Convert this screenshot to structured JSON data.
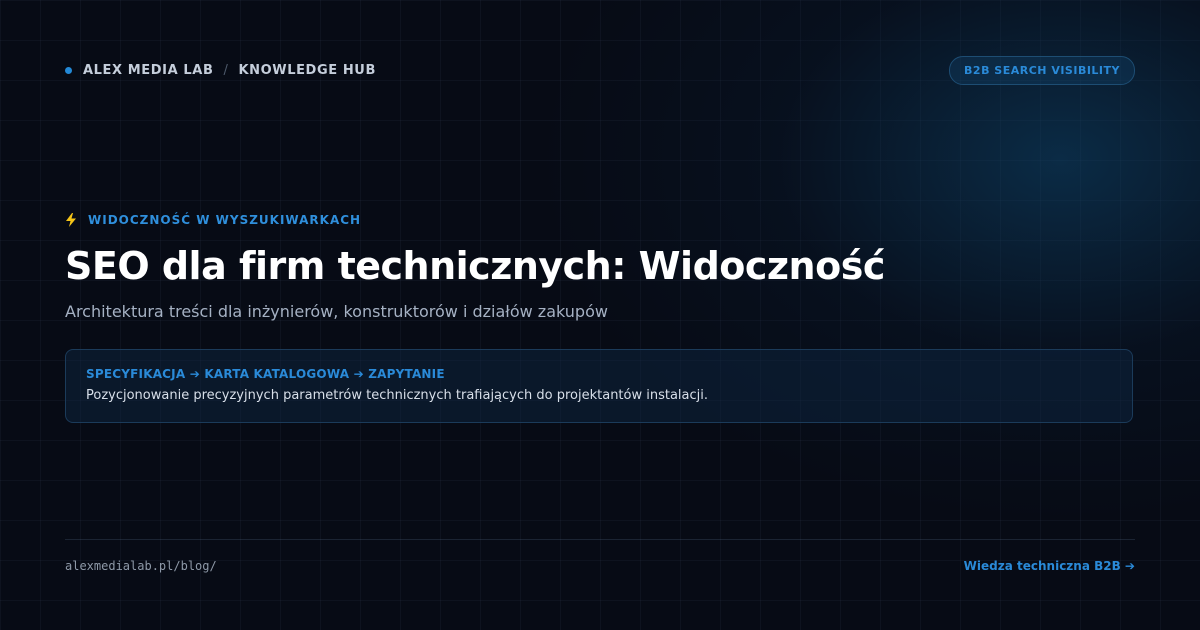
{
  "header": {
    "brand": "ALEX MEDIA LAB",
    "separator": "/",
    "section": "KNOWLEDGE HUB",
    "badge": "B2B SEARCH VISIBILITY"
  },
  "hero": {
    "kicker_icon": "lightning-bolt-icon",
    "kicker": "WIDOCZNOŚĆ W WYSZUKIWARKACH",
    "title": "SEO dla firm technicznych: Widoczność",
    "subtitle": "Architektura treści dla inżynierów, konstruktorów i działów zakupów"
  },
  "info_box": {
    "heading": "SPECYFIKACJA ➔ KARTA KATALOGOWA ➔ ZAPYTANIE",
    "text": "Pozycjonowanie precyzyjnych parametrów technicznych trafiających do projektantów instalacji."
  },
  "footer": {
    "url": "alexmedialab.pl/blog/",
    "link": "Wiedza techniczna B2B ➔"
  },
  "colors": {
    "background": "#070b15",
    "accent": "#2a8ad8",
    "bolt": "#f5c518"
  }
}
